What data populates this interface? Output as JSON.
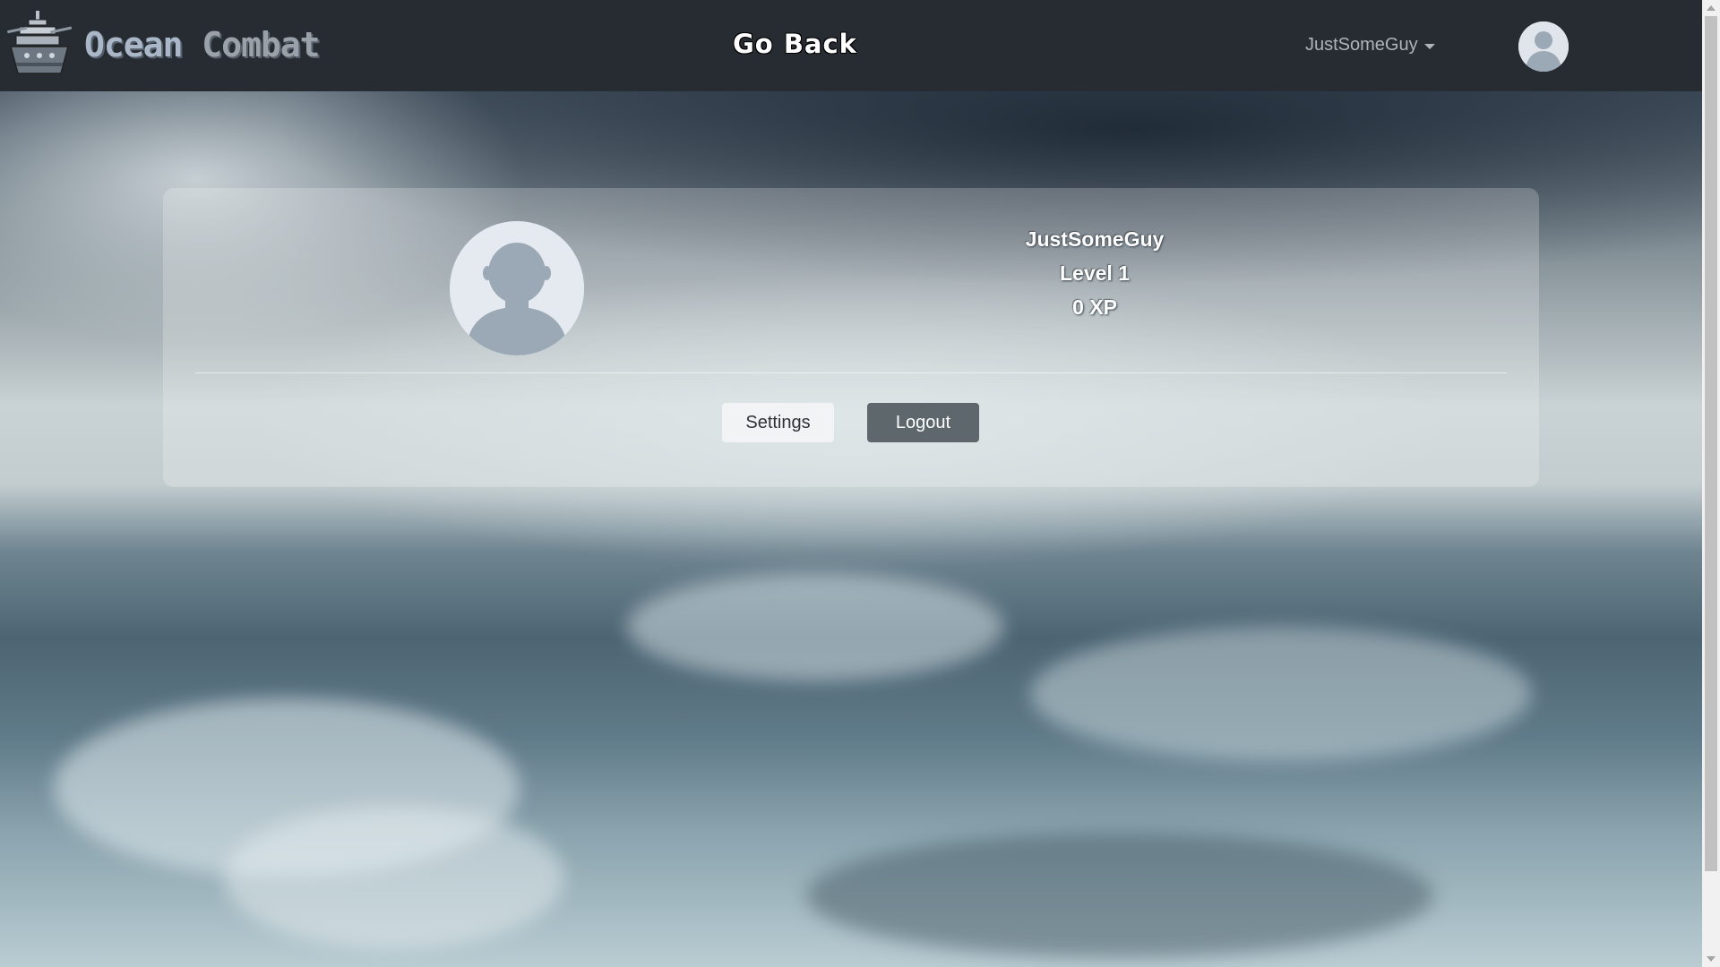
{
  "navbar": {
    "brand": {
      "word1": "Ocean",
      "word2": "Combat"
    },
    "go_back_label": "Go Back",
    "user_menu_label": "JustSomeGuy"
  },
  "profile": {
    "username": "JustSomeGuy",
    "level": "Level 1",
    "xp": "0 XP"
  },
  "actions": {
    "settings_label": "Settings",
    "logout_label": "Logout"
  },
  "colors": {
    "navbar_bg": "#272c32",
    "logout_button": "#5d676c",
    "settings_button": "#f1f3f4"
  },
  "icons": [
    "battleship-logo-icon",
    "user-avatar-icon",
    "caret-down-icon"
  ]
}
